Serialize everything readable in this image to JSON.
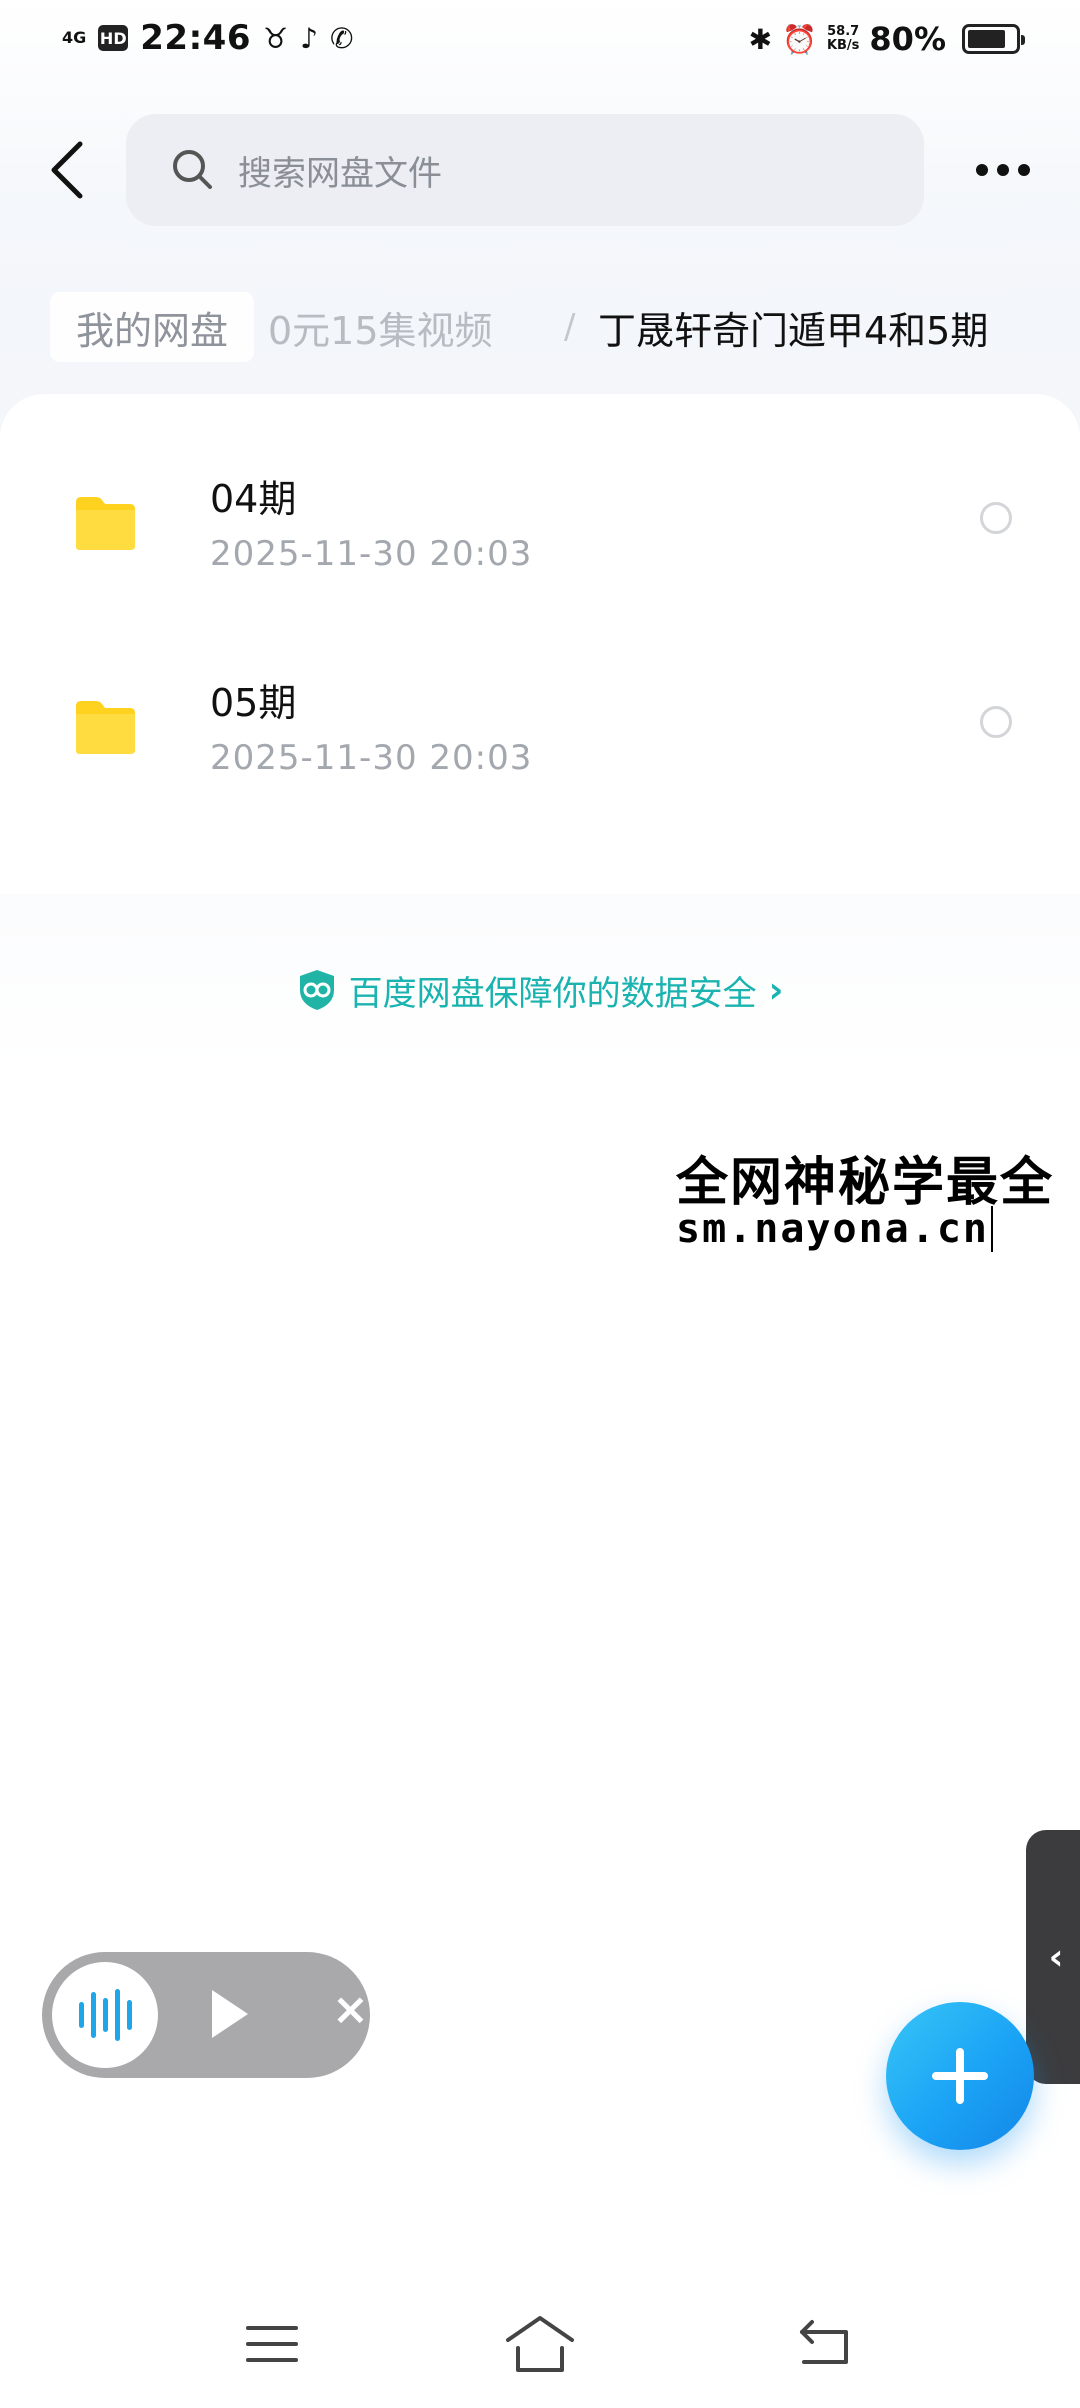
{
  "status_bar": {
    "signal": "4G",
    "hd": "HD",
    "time": "22:46",
    "net_speed_value": "58.7",
    "net_speed_unit": "KB/s",
    "battery_percent": "80%",
    "battery_level": 0.8,
    "icons": [
      "app-bull-icon",
      "tiktok-icon",
      "wechat-icon",
      "bluetooth-icon",
      "alarm-icon"
    ]
  },
  "header": {
    "search_placeholder": "搜索网盘文件"
  },
  "breadcrumb": {
    "home": "我的网盘",
    "middle": "0元15集视频",
    "separator": "/",
    "current": "丁晟轩奇门遁甲4和5期"
  },
  "files": [
    {
      "name": "04期",
      "date": "2025-11-30  20:03",
      "type": "folder"
    },
    {
      "name": "05期",
      "date": "2025-11-30  20:03",
      "type": "folder"
    }
  ],
  "security_banner": {
    "text": "百度网盘保障你的数据安全",
    "arrow": "›"
  },
  "watermark": {
    "line1": "全网神秘学最全",
    "line2": "sm.nayona.cn"
  },
  "audio_pill": {
    "close": "×"
  },
  "side_handle": {
    "arrow": "‹"
  },
  "colors": {
    "accent": "#1ab3b0",
    "fab": "#1aa3f5",
    "folder": "#ffd21f"
  }
}
